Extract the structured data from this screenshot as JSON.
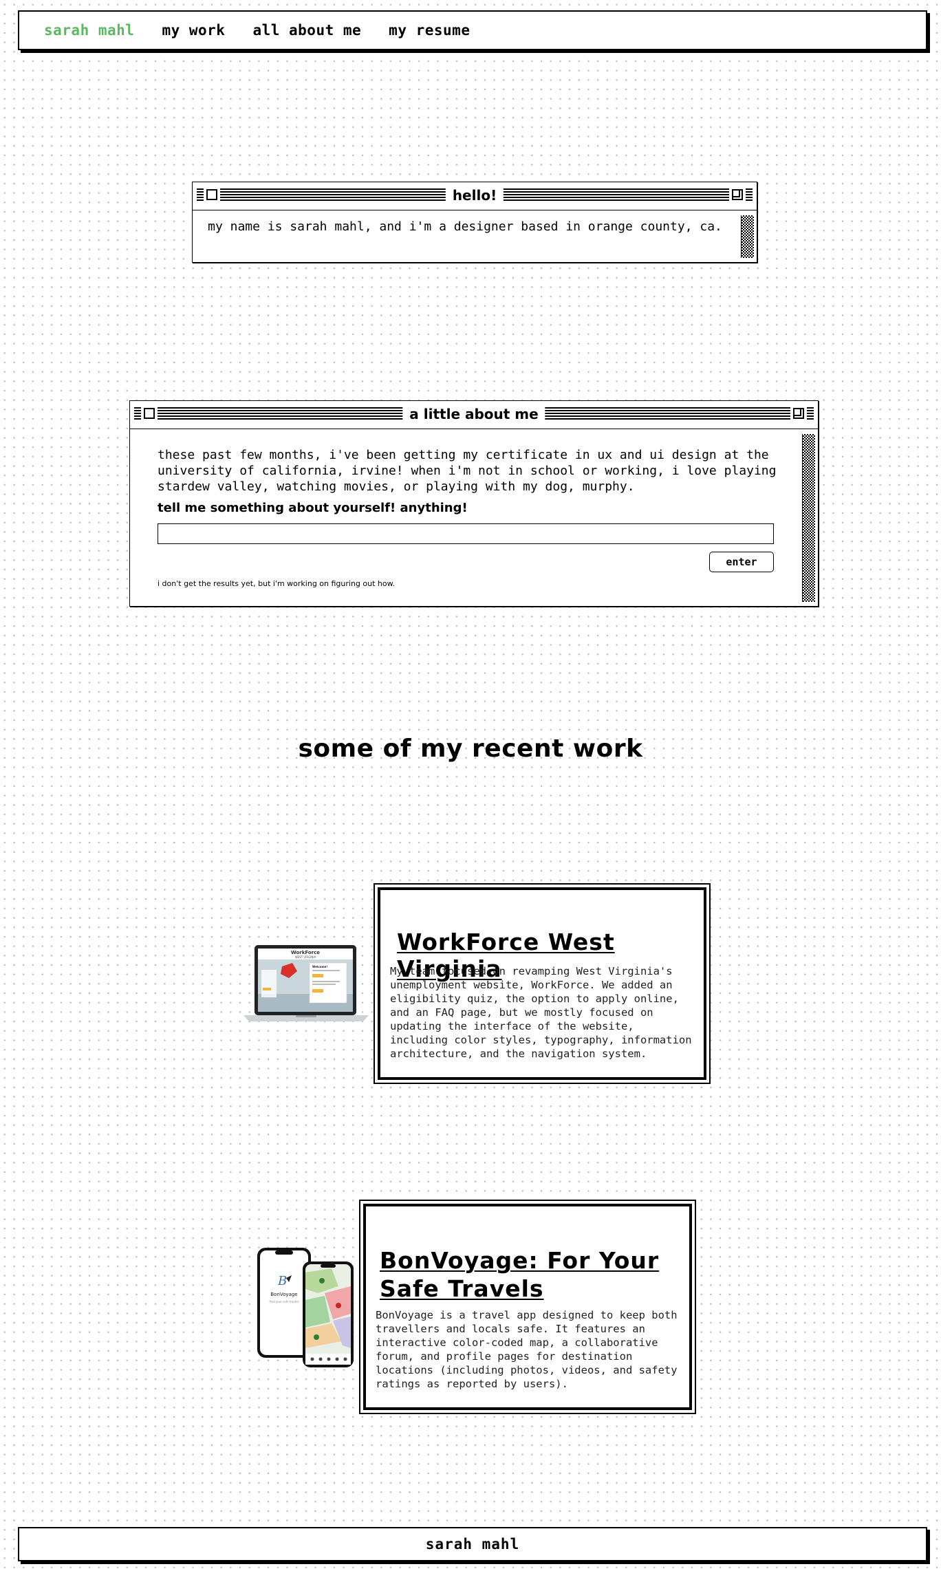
{
  "nav": {
    "brand": "sarah mahl",
    "items": [
      "my work",
      "all about me",
      "my resume"
    ]
  },
  "hello_window": {
    "title": "hello!",
    "text": "my name is sarah mahl, and i'm a designer based in orange county, ca."
  },
  "about_window": {
    "title": "a little about me",
    "paragraph_lines": [
      "these past few months, i've been getting my certificate in ux and ui design at the",
      "university of california, irvine! when i'm not in school or working, i love playing",
      "stardew valley, watching movies, or playing with my dog, murphy."
    ],
    "prompt": "tell me something about yourself! anything!",
    "input_value": "",
    "button_label": "enter",
    "note": "i don't get the results yet, but i'm working on figuring out how."
  },
  "section_heading": "some of my recent work",
  "projects": [
    {
      "title": "WorkForce West Virginia",
      "description": "My team focused on revamping West Virginia's unemployment website, WorkForce. We added an eligibility quiz, the option to apply online, and an FAQ page, but we mostly focused on updating the interface of the website, including color styles, typography, information architecture, and the navigation system.",
      "image": "laptop-mockup",
      "image_text": {
        "title": "WorkForce",
        "subtitle": "WEST VIRGINIA",
        "welcome": "Welcome!"
      }
    },
    {
      "title": "BonVoyage: For Your Safe Travels",
      "description": "BonVoyage is a travel app designed to keep both travellers and locals safe. It features an interactive color-coded map, a collaborative forum, and profile pages for destination locations (including photos, videos, and safety ratings as reported by users).",
      "image": "phone-mockup",
      "image_text": {
        "app_name": "BonVoyage",
        "tagline": "Find your safe travels"
      }
    }
  ],
  "footer": {
    "text": "sarah mahl"
  },
  "colors": {
    "brand_green": "#5cb860",
    "ink": "#000000",
    "background": "#ffffff",
    "dot": "#bdbdbd"
  }
}
